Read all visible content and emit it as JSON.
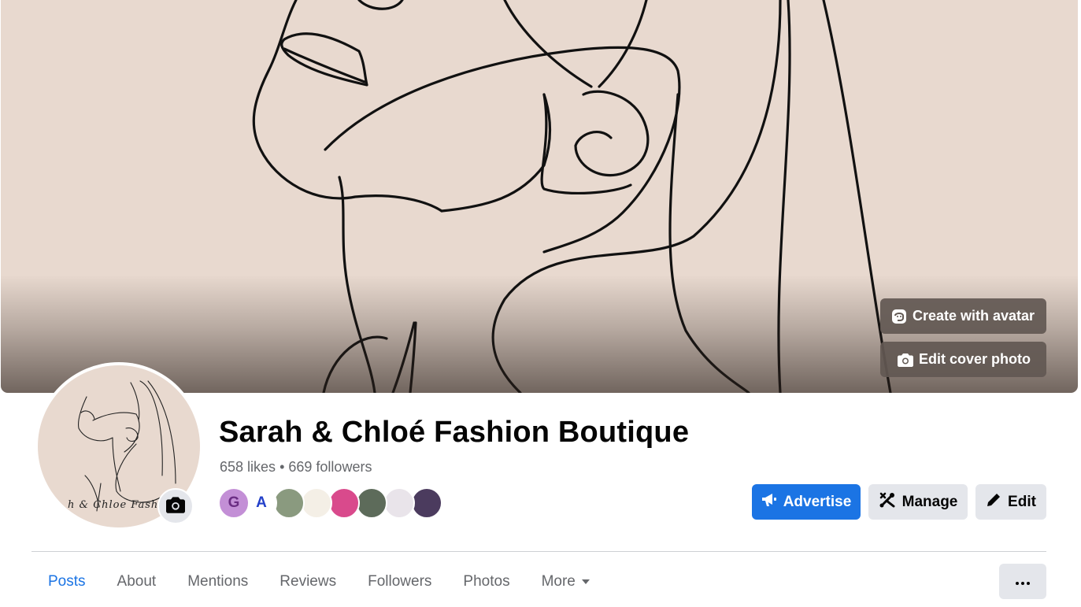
{
  "cover": {
    "create_avatar_label": "Create with avatar",
    "edit_cover_label": "Edit cover photo"
  },
  "profile": {
    "logo_text": "h & Chloe Fashion B"
  },
  "page": {
    "name": "Sarah & Chloé Fashion Boutique",
    "likes": "658 likes",
    "separator": "•",
    "followers": "669 followers"
  },
  "followers_preview": [
    {
      "initial": "G",
      "bg": "#c38fd6",
      "fg": "#6b2d83"
    },
    {
      "initial": "A",
      "bg": "#ffffff",
      "fg": "#2340c9"
    },
    {
      "initial": "",
      "bg": "#8a9a7f",
      "fg": "#ffffff"
    },
    {
      "initial": "",
      "bg": "#f4efe6",
      "fg": "#c9a227"
    },
    {
      "initial": "",
      "bg": "#d94a8c",
      "fg": "#ffffff"
    },
    {
      "initial": "",
      "bg": "#5d6b5a",
      "fg": "#ffffff"
    },
    {
      "initial": "",
      "bg": "#e9e4ea",
      "fg": "#333333"
    },
    {
      "initial": "",
      "bg": "#4b3b5e",
      "fg": "#ffffff"
    }
  ],
  "actions": {
    "advertise": "Advertise",
    "manage": "Manage",
    "edit": "Edit"
  },
  "tabs": [
    {
      "label": "Posts",
      "active": true
    },
    {
      "label": "About"
    },
    {
      "label": "Mentions"
    },
    {
      "label": "Reviews"
    },
    {
      "label": "Followers"
    },
    {
      "label": "Photos"
    },
    {
      "label": "More"
    }
  ],
  "colors": {
    "accent": "#1b74e4",
    "secondary_button": "#e4e6eb",
    "muted_text": "#65676b",
    "cover_bg": "#e8d9cf"
  }
}
